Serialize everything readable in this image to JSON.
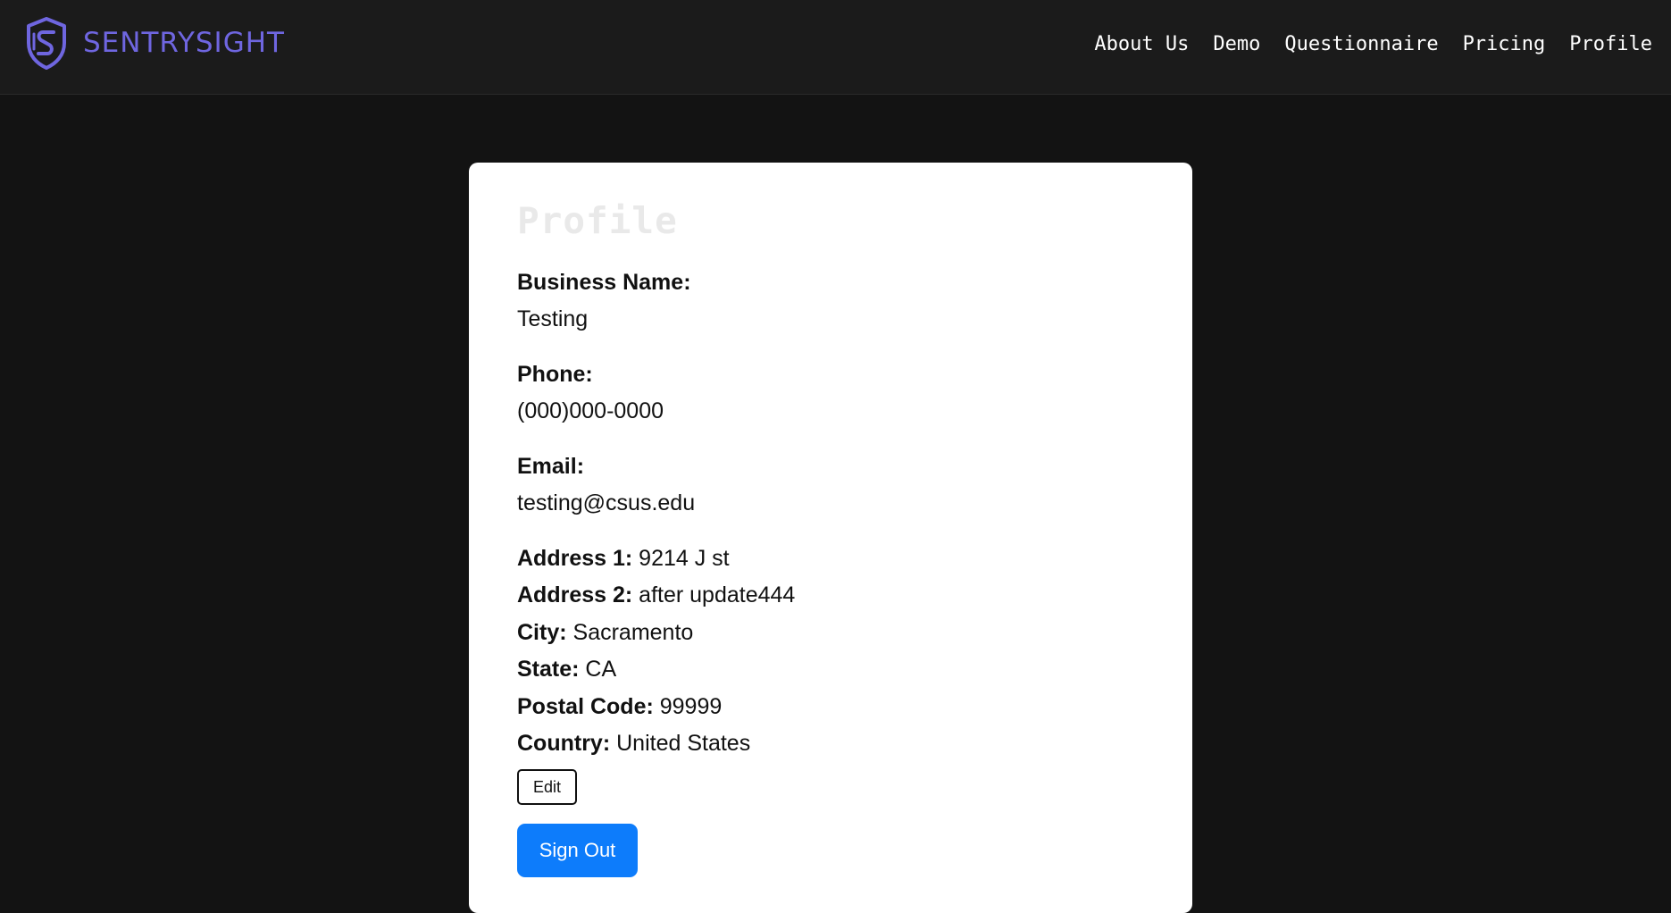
{
  "header": {
    "brand_name": "SENTRYSIGHT",
    "logo_icon": "shield-s-logo-icon",
    "nav_items": [
      "About Us",
      "Demo",
      "Questionnaire",
      "Pricing",
      "Profile"
    ]
  },
  "profile": {
    "title": "Profile",
    "business_name_label": "Business Name:",
    "business_name": "Testing",
    "phone_label": "Phone:",
    "phone": "(000)000-0000",
    "email_label": "Email:",
    "email": "testing@csus.edu",
    "address1_label": "Address 1:",
    "address1": "9214 J st",
    "address2_label": "Address 2:",
    "address2": "after update444",
    "city_label": "City:",
    "city": "Sacramento",
    "state_label": "State:",
    "state": "CA",
    "postal_code_label": "Postal Code:",
    "postal_code": "99999",
    "country_label": "Country:",
    "country": "United States",
    "edit_label": "Edit",
    "signout_label": "Sign Out"
  },
  "colors": {
    "page_bg": "#131313",
    "header_bg": "#1b1b1b",
    "brand": "#6f66e0",
    "card_bg": "#ffffff",
    "primary_button": "#0d7cfb"
  }
}
